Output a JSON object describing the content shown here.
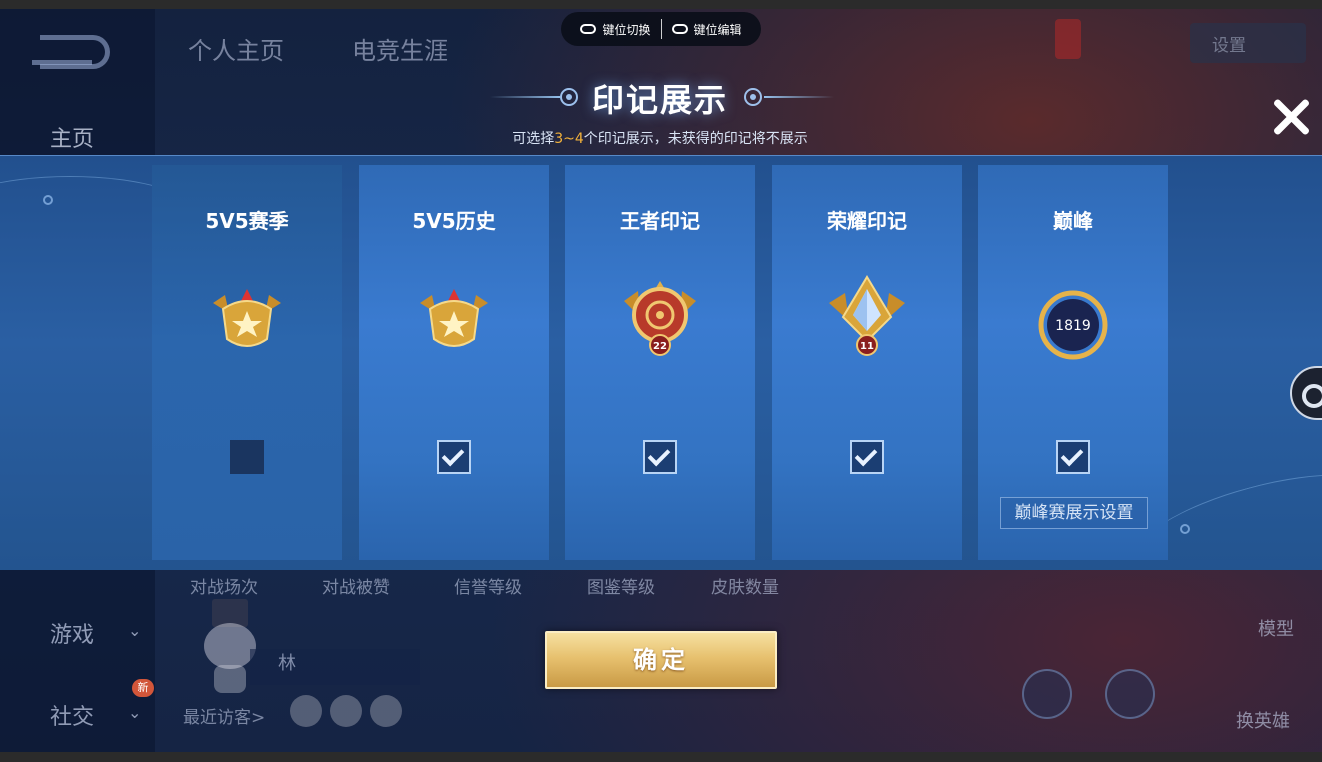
{
  "keymap_bar": {
    "switch_label": "键位切换",
    "edit_label": "键位编辑"
  },
  "background": {
    "tabs": [
      "个人主页",
      "电竞生涯"
    ],
    "nav": {
      "home": "主页",
      "game": "游戏",
      "social": "社交",
      "new_badge": "新"
    },
    "stats": [
      "对战场次",
      "对战被赞",
      "信誉等级",
      "图鉴等级",
      "皮肤数量"
    ],
    "player_name": "林",
    "recent_visitors": "最近访客>",
    "settings": "设置",
    "model": "模型",
    "switch_hero": "换英雄"
  },
  "modal": {
    "title": "印记展示",
    "subtitle_prefix": "可选择",
    "subtitle_range": "3~4",
    "subtitle_suffix": "个印记展示，未获得的印记将不展示",
    "cards": [
      {
        "label": "5V5赛季",
        "checked": false
      },
      {
        "label": "5V5历史",
        "checked": true
      },
      {
        "label": "王者印记",
        "checked": true,
        "badge": "22"
      },
      {
        "label": "荣耀印记",
        "checked": true,
        "badge": "11"
      },
      {
        "label": "巅峰",
        "checked": true,
        "score": "1819"
      }
    ],
    "peak_settings": "巅峰赛展示设置",
    "confirm": "确定"
  },
  "colors": {
    "accent_gold": "#e7c16f",
    "highlight_orange": "#f3b23b",
    "panel_blue": "#2a5fa3"
  }
}
